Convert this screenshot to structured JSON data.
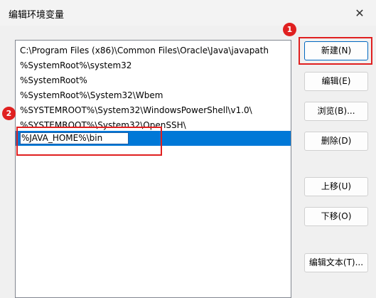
{
  "window": {
    "title": "编辑环境变量",
    "close_glyph": "✕"
  },
  "list": {
    "items": [
      "C:\\Program Files (x86)\\Common Files\\Oracle\\Java\\javapath",
      "%SystemRoot%\\system32",
      "%SystemRoot%",
      "%SystemRoot%\\System32\\Wbem",
      "%SYSTEMROOT%\\System32\\WindowsPowerShell\\v1.0\\",
      "%SYSTEMROOT%\\System32\\OpenSSH\\"
    ],
    "editing_value": "%JAVA_HOME%\\bin"
  },
  "buttons": {
    "new": "新建(N)",
    "edit": "编辑(E)",
    "browse": "浏览(B)...",
    "delete": "删除(D)",
    "move_up": "上移(U)",
    "move_down": "下移(O)",
    "edit_text": "编辑文本(T)..."
  },
  "annotations": {
    "step1": "1",
    "step2": "2"
  },
  "colors": {
    "selection": "#0078d7",
    "annotation_red": "#e02020"
  }
}
